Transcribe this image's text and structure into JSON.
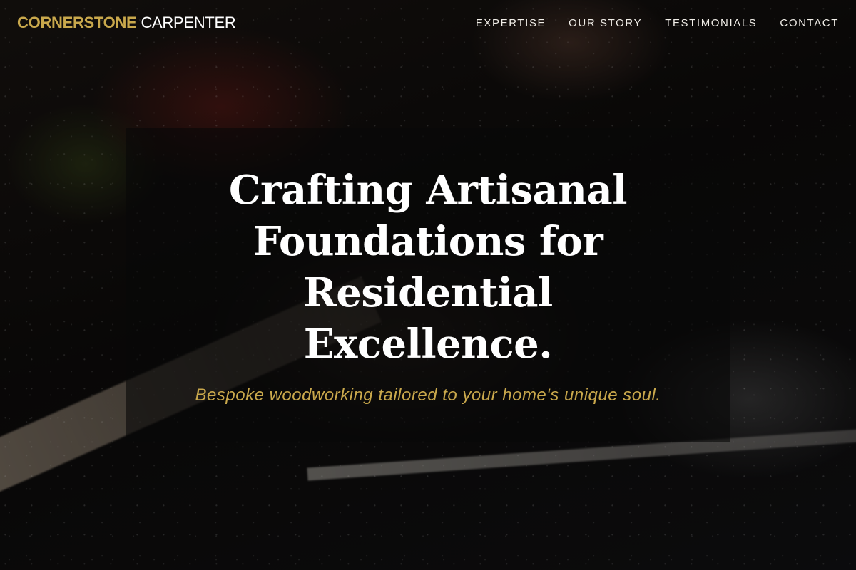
{
  "colors": {
    "accent": "#c9a84c",
    "text": "#ffffff",
    "overlay": "#080808"
  },
  "header": {
    "logo": {
      "primary": "CORNERSTONE",
      "secondary": "CARPENTER"
    },
    "nav": [
      {
        "label": "EXPERTISE"
      },
      {
        "label": "OUR STORY"
      },
      {
        "label": "TESTIMONIALS"
      },
      {
        "label": "CONTACT"
      }
    ]
  },
  "hero": {
    "background": "woodworking-workshop-photo",
    "title": "Crafting Artisanal Foundations for Residential Excellence.",
    "subtitle": "Bespoke woodworking tailored to your home's unique soul."
  }
}
